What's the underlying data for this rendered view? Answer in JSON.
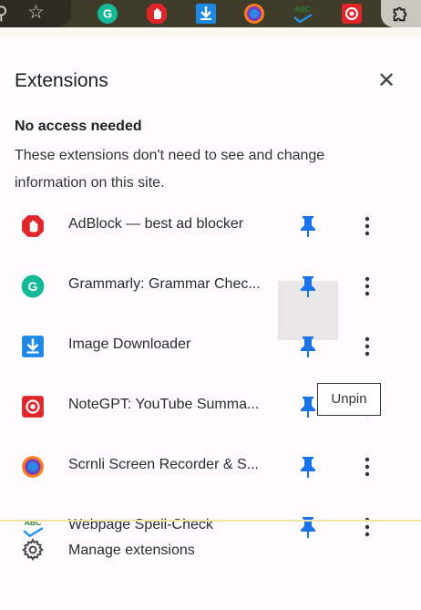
{
  "toolbar": {
    "icons": [
      "search-icon",
      "star-icon",
      "grammarly-icon",
      "adblock-icon",
      "image-downloader-icon",
      "scrnli-icon",
      "spell-check-icon",
      "notegpt-icon",
      "extensions-puzzle-icon"
    ]
  },
  "panel": {
    "title": "Extensions",
    "close_icon": "close-icon",
    "section_heading": "No access needed",
    "section_description": "These extensions don't need to see and change information on this site."
  },
  "extensions": [
    {
      "label": "AdBlock — best ad blocker",
      "icon": "adblock-icon",
      "pinned": true
    },
    {
      "label": "Grammarly: Grammar Chec...",
      "icon": "grammarly-icon",
      "pinned": true
    },
    {
      "label": "Image Downloader",
      "icon": "image-downloader-icon",
      "pinned": true
    },
    {
      "label": "NoteGPT: YouTube Summa...",
      "icon": "notegpt-icon",
      "pinned": true
    },
    {
      "label": "Scrnli Screen Recorder & S...",
      "icon": "scrnli-icon",
      "pinned": true
    },
    {
      "label": "Webpage Spell-Check",
      "icon": "spell-check-icon",
      "pinned": true
    }
  ],
  "tooltip": {
    "text": "Unpin"
  },
  "footer": {
    "manage_label": "Manage extensions"
  },
  "colors": {
    "pin": "#1a73e8",
    "adblock": "#e0262b",
    "grammarly": "#16b89a",
    "downloader": "#1e88e5",
    "notegpt": "#e0262b"
  }
}
